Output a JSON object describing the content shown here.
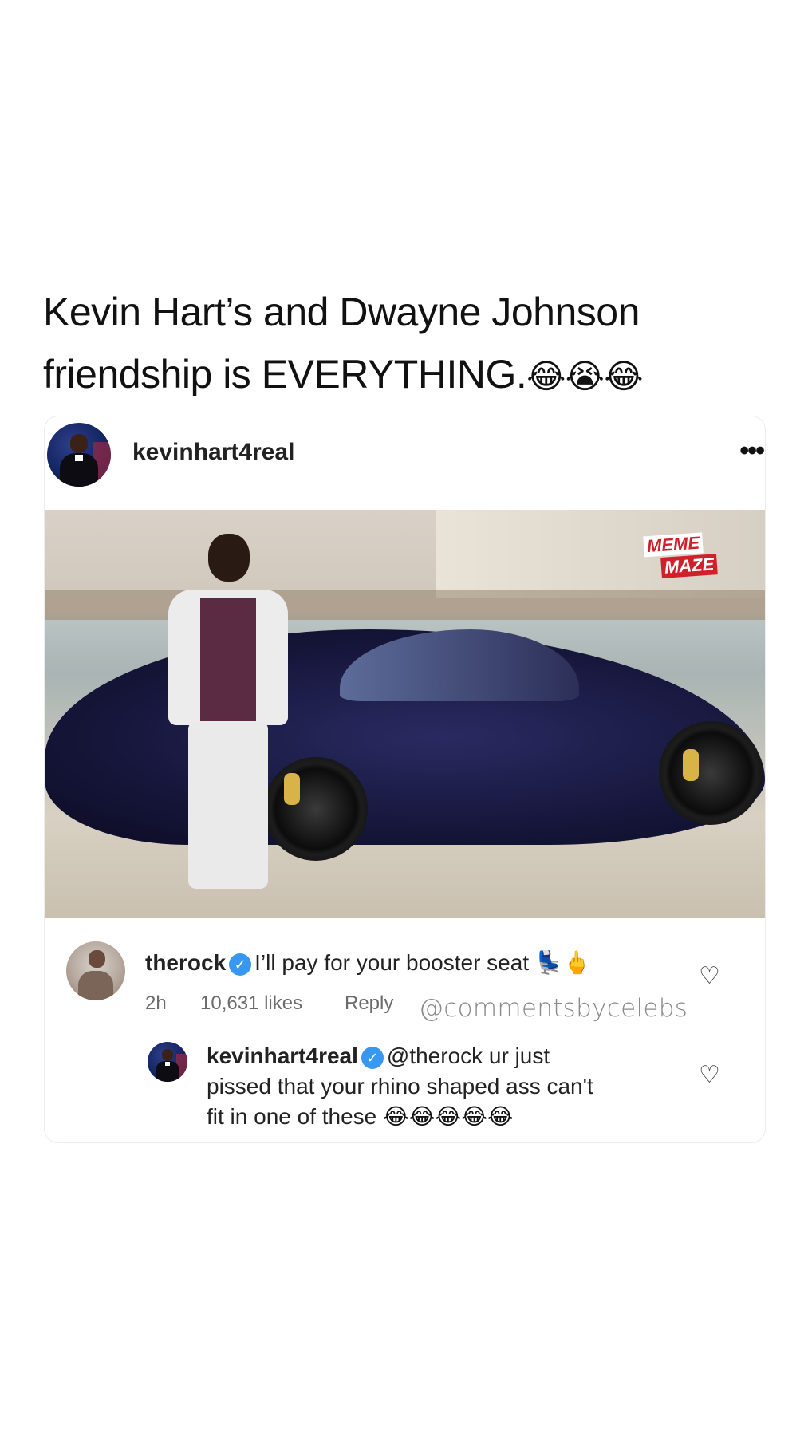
{
  "headline": {
    "line1": "Kevin Hart’s and Dwayne Johnson",
    "line2": "friendship is EVERYTHING.",
    "emojis": "😂😭😂"
  },
  "post": {
    "username": "kevinhart4real",
    "more_icon": "•••",
    "watermark_top": "MEME",
    "watermark_bottom": "MAZE"
  },
  "comment1": {
    "username": "therock",
    "text": "I’ll pay for your booster seat",
    "emoji": "💺🖕",
    "time": "2h",
    "likes": "10,631 likes",
    "reply": "Reply",
    "credit": "@commentsbycelebs"
  },
  "comment2": {
    "username": "kevinhart4real",
    "line1": "@therock ur just",
    "line2": "pissed that your rhino shaped ass can't",
    "line3": "fit in one of these",
    "emoji": "😂😂😂😂😂"
  },
  "colors": {
    "verified": "#3897f0",
    "watermark_red": "#d0202a"
  }
}
